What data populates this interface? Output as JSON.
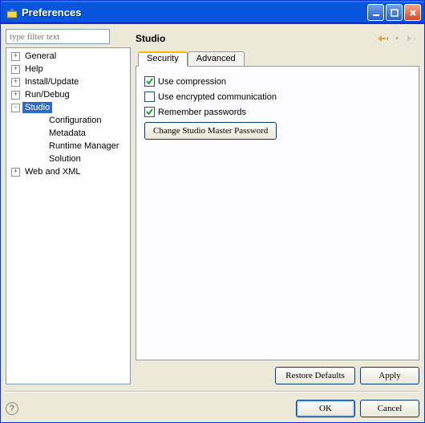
{
  "window": {
    "title": "Preferences"
  },
  "filter": {
    "placeholder": "type filter text"
  },
  "tree": {
    "items": [
      {
        "label": "General",
        "depth": 0,
        "twisty": "+"
      },
      {
        "label": "Help",
        "depth": 0,
        "twisty": "+"
      },
      {
        "label": "Install/Update",
        "depth": 0,
        "twisty": "+"
      },
      {
        "label": "Run/Debug",
        "depth": 0,
        "twisty": "+"
      },
      {
        "label": "Studio",
        "depth": 0,
        "twisty": "-",
        "selected": true
      },
      {
        "label": "Configuration",
        "depth": 1,
        "twisty": ""
      },
      {
        "label": "Metadata",
        "depth": 1,
        "twisty": ""
      },
      {
        "label": "Runtime Manager",
        "depth": 1,
        "twisty": ""
      },
      {
        "label": "Solution",
        "depth": 1,
        "twisty": ""
      },
      {
        "label": "Web and XML",
        "depth": 0,
        "twisty": "+"
      }
    ]
  },
  "page": {
    "title": "Studio",
    "tabs": {
      "security": "Security",
      "advanced": "Advanced"
    },
    "security": {
      "use_compression": "Use compression",
      "use_encrypted": "Use encrypted communication",
      "remember_passwords": "Remember passwords",
      "change_password_btn": "Change Studio Master Password"
    },
    "restore_defaults": "Restore Defaults",
    "apply": "Apply"
  },
  "footer": {
    "ok": "OK",
    "cancel": "Cancel"
  }
}
